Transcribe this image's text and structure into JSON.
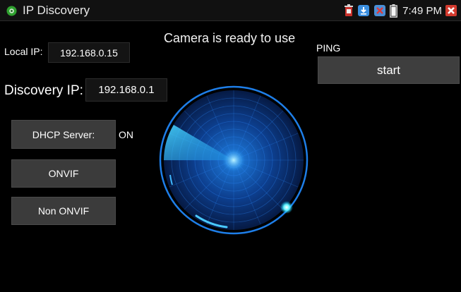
{
  "status_bar": {
    "app_title": "IP Discovery",
    "time": "7:49 PM",
    "icons": [
      "app-camera-icon",
      "notification-bin-icon",
      "download-icon",
      "alert-icon",
      "battery-icon",
      "close-icon"
    ]
  },
  "network": {
    "local_ip_label": "Local IP:",
    "local_ip_value": "192.168.0.15",
    "discovery_ip_label": "Discovery IP:",
    "discovery_ip_value": "192.168.0.1"
  },
  "buttons": {
    "dhcp_label": "DHCP Server:",
    "dhcp_state": "ON",
    "onvif_label": "ONVIF",
    "non_onvif_label": "Non ONVIF"
  },
  "status_message": "Camera is ready to use",
  "ping": {
    "label": "PING",
    "start_label": "start"
  },
  "colors": {
    "radar_ring": "#1e7ee8",
    "radar_sweep": "#3cc6ff",
    "button_bg": "#3b3b3b",
    "background": "#000000"
  }
}
